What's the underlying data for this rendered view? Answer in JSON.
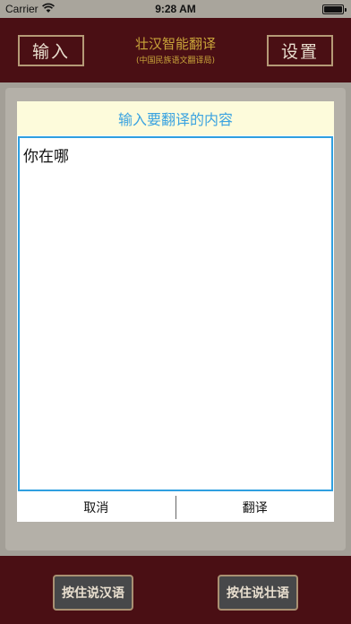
{
  "status_bar": {
    "carrier": "Carrier",
    "time": "9:28 AM",
    "battery_level": 1.0
  },
  "header": {
    "left_button": "输入",
    "title": "壮汉智能翻译",
    "subtitle": "(中国民族语文翻译局)",
    "right_button": "设置"
  },
  "dialog": {
    "title": "输入要翻译的内容",
    "input_value": "你在哪",
    "cancel_label": "取消",
    "translate_label": "翻译",
    "accent_color": "#2f9fe0"
  },
  "footer": {
    "left_button": "按住说汉语",
    "right_button": "按住说壮语"
  },
  "colors": {
    "header_bg": "#4a0f14",
    "title_gold": "#c9a43a"
  }
}
